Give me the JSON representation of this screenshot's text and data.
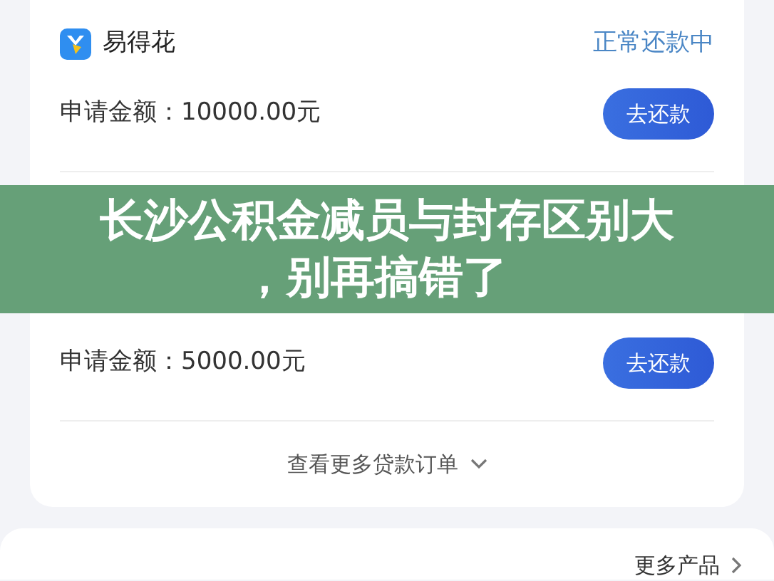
{
  "orders": [
    {
      "app_name": "易得花",
      "status": "正常还款中",
      "amount_label": "申请金额：",
      "amount": "10000.00元",
      "button": "去还款"
    },
    {
      "amount_label": "申请金额：",
      "amount": "5000.00元",
      "button": "去还款"
    }
  ],
  "more_orders": "查看更多贷款订单",
  "more_products": "更多产品",
  "banner": {
    "title_lines": [
      "长沙公积金减员与封存区别大",
      "，别再搞错了"
    ]
  }
}
